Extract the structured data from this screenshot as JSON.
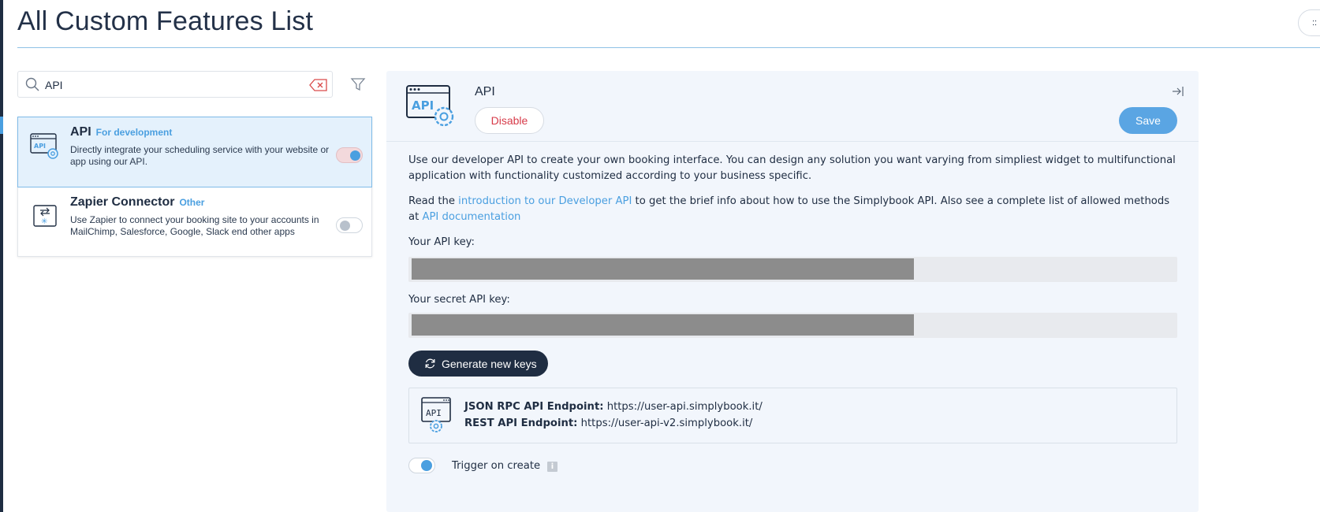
{
  "page": {
    "title": "All Custom Features List",
    "corner_button_glyph": "::"
  },
  "search": {
    "value": "API",
    "placeholder": ""
  },
  "features": [
    {
      "name": "API",
      "category": "For development",
      "description": "Directly integrate your scheduling service with your website or app using our API.",
      "enabled": true,
      "selected": true,
      "icon": "api-gear-icon"
    },
    {
      "name": "Zapier Connector",
      "category": "Other",
      "description": "Use Zapier to connect your booking site to your accounts in MailChimp, Salesforce, Google, Slack end other apps",
      "enabled": false,
      "selected": false,
      "icon": "zapier-connector-icon"
    }
  ],
  "detail": {
    "title": "API",
    "disable_label": "Disable",
    "save_label": "Save",
    "intro": "Use our developer API to create your own booking interface. You can design any solution you want varying from simpliest widget to multifunctional application with functionality customized according to your business specific.",
    "read_prefix": "Read the ",
    "intro_link": "introduction to our Developer API",
    "read_middle": " to get the brief info about how to use the Simplybook API. Also see a complete list of allowed methods at ",
    "docs_link": "API documentation",
    "api_key_label": "Your API key:",
    "secret_key_label": "Your secret API key:",
    "generate_label": "Generate new keys",
    "json_rpc_label": "JSON RPC API Endpoint:",
    "json_rpc_url": "https://user-api.simplybook.it/",
    "rest_label": "REST API Endpoint:",
    "rest_url": "https://user-api-v2.simplybook.it/",
    "trigger_label": "Trigger on create",
    "trigger_enabled": true,
    "info_glyph": "i"
  },
  "colors": {
    "accent": "#4a9fe0",
    "navy": "#1f2d42",
    "danger": "#d73a49",
    "save": "#5aa5e3",
    "panel_bg": "#f2f6fc"
  }
}
